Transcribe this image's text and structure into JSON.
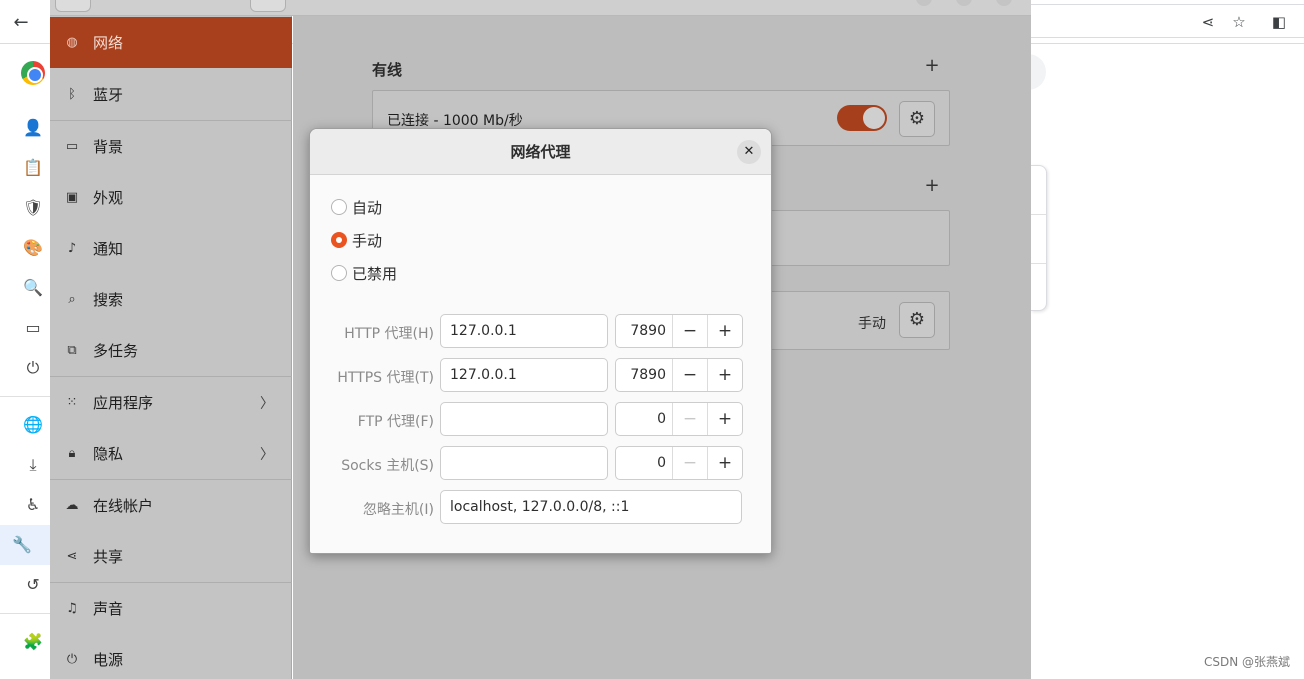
{
  "settings": {
    "sidebar": {
      "items": [
        {
          "label": "网络",
          "icon": "globe-icon"
        },
        {
          "label": "蓝牙",
          "icon": "bluetooth-icon"
        },
        {
          "label": "背景",
          "icon": "display-icon"
        },
        {
          "label": "外观",
          "icon": "appearance-icon"
        },
        {
          "label": "通知",
          "icon": "bell-icon"
        },
        {
          "label": "搜索",
          "icon": "search-icon"
        },
        {
          "label": "多任务",
          "icon": "multitasking-icon"
        },
        {
          "label": "应用程序",
          "icon": "apps-grid-icon"
        },
        {
          "label": "隐私",
          "icon": "lock-icon"
        },
        {
          "label": "在线帐户",
          "icon": "cloud-icon"
        },
        {
          "label": "共享",
          "icon": "share-icon"
        },
        {
          "label": "声音",
          "icon": "music-note-icon"
        },
        {
          "label": "电源",
          "icon": "power-icon"
        }
      ]
    },
    "main": {
      "wired_title": "有线",
      "wired_status": "已连接 - 1000 Mb/秒",
      "proxy_status": "手动"
    }
  },
  "dialog": {
    "title": "网络代理",
    "close_glyph": "✕",
    "methods": [
      "自动",
      "手动",
      "已禁用"
    ],
    "selected_method": "手动",
    "fields": {
      "http_label": "HTTP 代理(H)",
      "http_host": "127.0.0.1",
      "http_port": "7890",
      "https_label": "HTTPS 代理(T)",
      "https_host": "127.0.0.1",
      "https_port": "7890",
      "ftp_label": "FTP 代理(F)",
      "ftp_host": "",
      "ftp_port": "0",
      "socks_label": "Socks 主机(S)",
      "socks_host": "",
      "socks_port": "0",
      "ignore_label": "忽略主机(I)",
      "ignore_hosts": "localhost, 127.0.0.0/8, ::1"
    }
  },
  "watermark": "CSDN @张燕斌",
  "colors": {
    "accent": "#e95420",
    "sidebar_active": "#a8401e",
    "chrome_active": "#1a73e8"
  }
}
